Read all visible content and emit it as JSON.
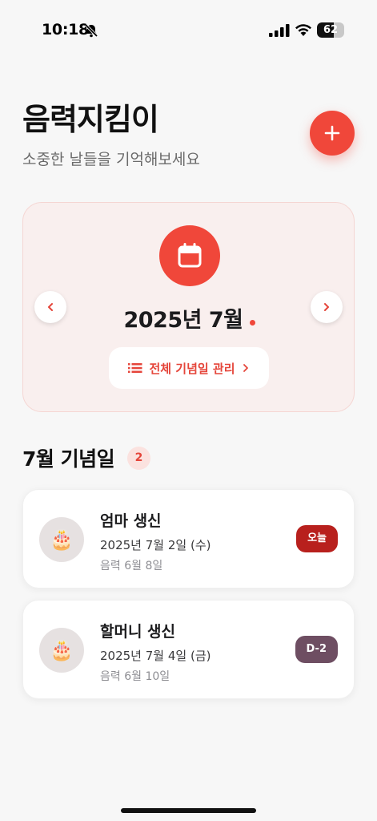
{
  "status_bar": {
    "time": "10:18",
    "battery": "62",
    "battery_level": 0.62,
    "icons": [
      "bell-slash-icon",
      "cellular-signal-icon",
      "wifi-icon",
      "battery-icon"
    ]
  },
  "header": {
    "title": "음력지킴이",
    "subtitle": "소중한 날들을 기억해보세요",
    "add_button_icon": "plus-icon"
  },
  "month_card": {
    "month_label": "2025년 7월",
    "prev_icon": "chevron-left-icon",
    "next_icon": "chevron-right-icon",
    "calendar_icon": "calendar-icon",
    "manage_label": "전체 기념일 관리",
    "manage_icon": "list-icon"
  },
  "section": {
    "title": "7월 기념일",
    "count": "2"
  },
  "events": [
    {
      "name": "엄마 생신",
      "date": "2025년 7월 2일 (수)",
      "lunar": "음력 6월 8일",
      "badge": "오늘",
      "badge_color": "#b8201d",
      "avatar": "🎂"
    },
    {
      "name": "할머니 생신",
      "date": "2025년 7월 4일 (금)",
      "lunar": "음력 6월 10일",
      "badge": "D-2",
      "badge_color": "#6e4e62",
      "avatar": "🎂"
    }
  ],
  "colors": {
    "accent": "#f0473a",
    "card_bg": "#f9efee",
    "page_bg": "#f7f7f7"
  }
}
